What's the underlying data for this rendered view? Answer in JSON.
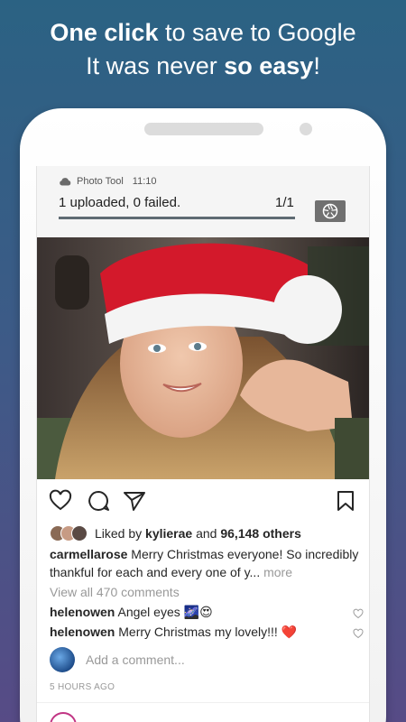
{
  "promo": {
    "line1_bold": "One click",
    "line1_rest": " to save to Google",
    "line2_start": "It was never ",
    "line2_bold": "so easy",
    "line2_end": "!"
  },
  "notification": {
    "app_name": "Photo Tool",
    "time": "11:10",
    "message": "1 uploaded, 0 failed.",
    "count": "1/1",
    "progress": 1.0,
    "icons": [
      "cloud-icon",
      "camera-shutter-icon"
    ]
  },
  "post": {
    "actions": [
      "heart-icon",
      "comment-icon",
      "share-icon",
      "bookmark-icon"
    ],
    "liked_by_prefix": "Liked by ",
    "liked_by_user": "kylierae",
    "liked_by_mid": " and ",
    "liked_by_count": "96,148 others",
    "caption_user": "carmellarose",
    "caption_text": " Merry Christmas everyone! So incredibly thankful for each and every one of y...",
    "caption_more": " more",
    "view_all": "View all 470 comments",
    "comments": [
      {
        "user": "helenowen",
        "text": " Angel eyes 🌌😍"
      },
      {
        "user": "helenowen",
        "text": " Merry Christmas my lovely!!! ❤️"
      }
    ],
    "add_comment_placeholder": "Add a comment...",
    "time_ago": "5 HOURS AGO"
  },
  "colors": {
    "bg_top": "#2b6283",
    "bg_bottom": "#574b86",
    "progress": "#5f6b73",
    "text": "#262626",
    "muted": "#999999"
  }
}
